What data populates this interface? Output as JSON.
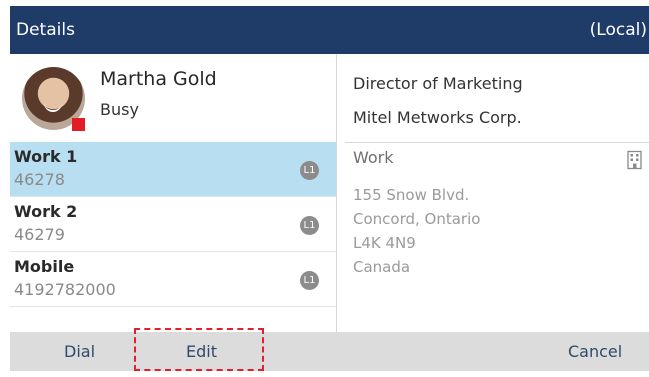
{
  "header": {
    "title": "Details",
    "directory": "(Local)"
  },
  "contact": {
    "name": "Martha Gold",
    "presence": "Busy",
    "title": "Director of Marketing",
    "company": "Mitel Metworks Corp."
  },
  "numbers": [
    {
      "label": "Work 1",
      "value": "46278",
      "line": "L1",
      "selected": true
    },
    {
      "label": "Work 2",
      "value": "46279",
      "line": "L1",
      "selected": false
    },
    {
      "label": "Mobile",
      "value": "4192782000",
      "line": "L1",
      "selected": false
    }
  ],
  "address": {
    "type": "Work",
    "lines": [
      "155 Snow Blvd.",
      "Concord, Ontario",
      "L4K 4N9",
      "Canada"
    ]
  },
  "softkeys": {
    "dial": "Dial",
    "edit": "Edit",
    "cancel": "Cancel"
  },
  "colors": {
    "titlebar": "#1f3b68",
    "selected_row": "#b8def1",
    "presence_busy": "#e01e24",
    "softkey_bar": "#dcdcdc",
    "annotation": "#e0202a"
  },
  "icons": {
    "presence": "presence-busy-icon",
    "address": "building-icon",
    "line": "line-badge-icon"
  }
}
